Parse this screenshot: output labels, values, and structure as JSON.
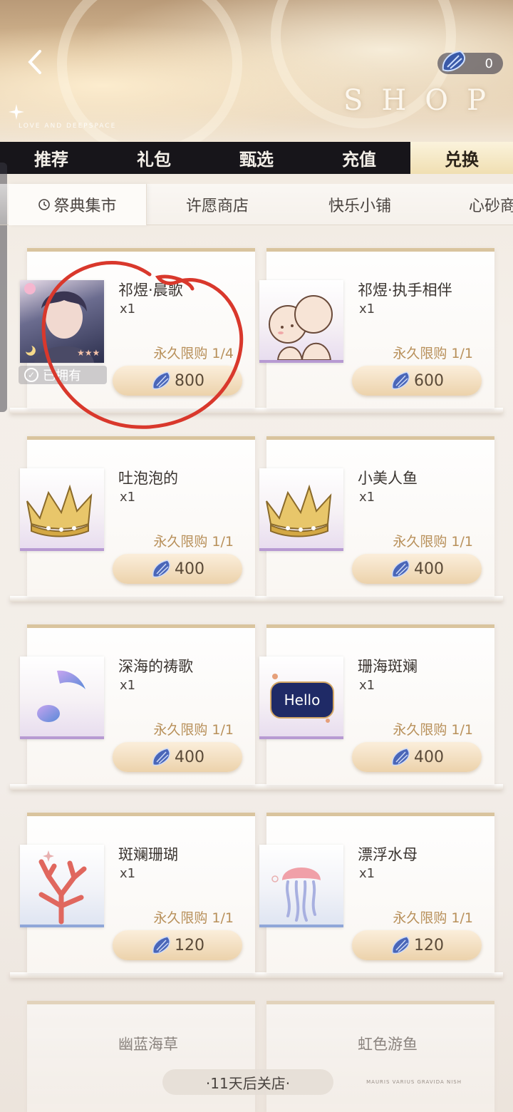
{
  "header": {
    "currency_count": "0",
    "logo_text": "SHOP",
    "logo_strip": "LOVE AND DEEPSPACE"
  },
  "main_tabs": [
    {
      "label": "推荐"
    },
    {
      "label": "礼包"
    },
    {
      "label": "甄选"
    },
    {
      "label": "充值"
    },
    {
      "label": "兑换",
      "active": true
    }
  ],
  "sub_tabs": [
    {
      "label": "祭典集市",
      "active": true
    },
    {
      "label": "许愿商店"
    },
    {
      "label": "快乐小铺"
    },
    {
      "label": "心砂商"
    }
  ],
  "items": [
    {
      "name": "祁煜·晨歌",
      "qty": "x1",
      "limit": "永久限购 1/4",
      "price": "800",
      "owned": "已拥有",
      "icon": "portrait-card-icon"
    },
    {
      "name": "祁煜·执手相伴",
      "qty": "x1",
      "limit": "永久限购 1/1",
      "price": "600",
      "icon": "chibi-sticker-icon"
    },
    {
      "name": "吐泡泡的",
      "qty": "x1",
      "limit": "永久限购 1/1",
      "price": "400",
      "icon": "crown-icon"
    },
    {
      "name": "小美人鱼",
      "qty": "x1",
      "limit": "永久限购 1/1",
      "price": "400",
      "icon": "crown-icon"
    },
    {
      "name": "深海的祷歌",
      "qty": "x1",
      "limit": "永久限购 1/1",
      "price": "400",
      "icon": "music-note-icon"
    },
    {
      "name": "珊海斑斓",
      "qty": "x1",
      "limit": "永久限购 1/1",
      "price": "400",
      "icon": "hello-badge-icon",
      "badge_text": "Hello"
    },
    {
      "name": "斑斓珊瑚",
      "qty": "x1",
      "limit": "永久限购 1/1",
      "price": "120",
      "icon": "coral-icon"
    },
    {
      "name": "漂浮水母",
      "qty": "x1",
      "limit": "永久限购 1/1",
      "price": "120",
      "icon": "jellyfish-icon"
    },
    {
      "name": "幽蓝海草",
      "icon": "partial-item"
    },
    {
      "name": "虹色游鱼",
      "icon": "partial-item"
    }
  ],
  "footer": {
    "close_notice": "·11天后关店·",
    "watermark": "MAURIS VARIUS GRAVIDA NISH"
  },
  "colors": {
    "tab_bar": "#17151a",
    "active_tab": "#f0dfb2",
    "limit_text": "#b8905a",
    "annotation": "#d9382c"
  }
}
